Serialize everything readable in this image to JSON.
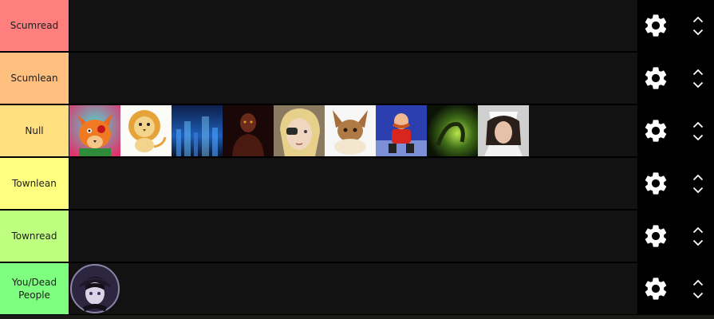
{
  "tiers": [
    {
      "label": "Scumread",
      "color": "#ff7f7f"
    },
    {
      "label": "Scumlean",
      "color": "#ffbf7f"
    },
    {
      "label": "Null",
      "color": "#ffdf7f"
    },
    {
      "label": "Townlean",
      "color": "#ffff7f"
    },
    {
      "label": "Townread",
      "color": "#bfff7f"
    },
    {
      "label": "You/Dead People",
      "color": "#7fff7f"
    }
  ],
  "null_items": [
    {
      "icon": "fox-avatar-icon"
    },
    {
      "icon": "lion-cartoon-avatar-icon"
    },
    {
      "icon": "blue-cityscape-avatar-icon"
    },
    {
      "icon": "dark-red-figure-avatar-icon"
    },
    {
      "icon": "blond-anime-character-avatar-icon"
    },
    {
      "icon": "eevee-avatar-icon"
    },
    {
      "icon": "robotnik-avatar-icon"
    },
    {
      "icon": "green-glow-creature-avatar-icon"
    },
    {
      "icon": "nurse-photo-avatar-icon"
    }
  ],
  "dead_items": [
    {
      "icon": "dark-anime-character-avatar-icon"
    }
  ],
  "control_icons": {
    "settings": "gear-icon",
    "move_up": "chevron-up-icon",
    "move_down": "chevron-down-icon"
  }
}
